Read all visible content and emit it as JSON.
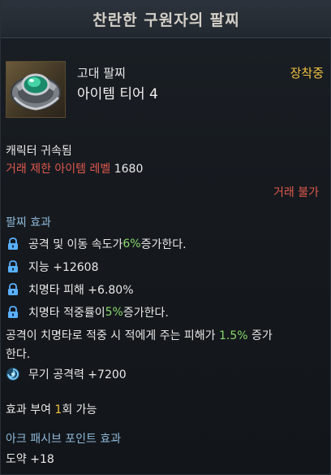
{
  "title": "찬란한 구원자의 팔찌",
  "item": {
    "grade": "고대 팔찌",
    "tier": "아이템 티어 4",
    "equipped": "장착중"
  },
  "binding": "캐릭터 귀속됨",
  "trade_level": {
    "label": "거래 제한 아이템 레벨",
    "value": "1680"
  },
  "trade_status": "거래 불가",
  "effect_header": "팔찌 효과",
  "effects": [
    {
      "pre": "공격 및 이동 속도가 ",
      "hl": "6%",
      "post": " 증가한다."
    },
    {
      "pre": "지능 +12608",
      "hl": "",
      "post": ""
    },
    {
      "pre": "치명타 피해 +6.80%",
      "hl": "",
      "post": ""
    },
    {
      "pre": "치명타 적중률이 ",
      "hl": "5%",
      "post": " 증가한다."
    }
  ],
  "crit_note": {
    "pre": "공격이 치명타로 적중 시 적에게 주는 피해가 ",
    "hl": "1.5%",
    "post": " 증가",
    "line2": "한다."
  },
  "weapon_atk": "무기 공격력 +7200",
  "apply": {
    "pre": "효과 부여 ",
    "hl": "1",
    "post": "회 가능"
  },
  "ark_header": "아크 패시브 포인트 효과",
  "ark_value": "도약 +18",
  "colors": {
    "highlight_green": "#8ad86c",
    "highlight_yellow": "#f0c040",
    "warning_red": "#e0584c",
    "section_blue": "#8fb8d8"
  }
}
